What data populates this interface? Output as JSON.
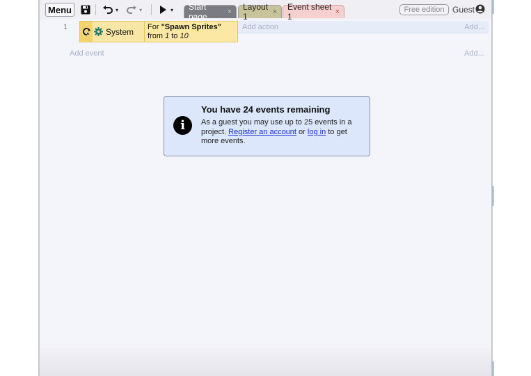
{
  "toolbar": {
    "menu_label": "Menu",
    "icons": [
      "save-icon",
      "undo-icon",
      "redo-icon",
      "play-icon"
    ],
    "undo_caret": "▾",
    "redo_caret": "▾",
    "play_caret": "▾"
  },
  "tabs": [
    {
      "label": "Start page",
      "close": "×"
    },
    {
      "label": "Layout 1",
      "close": "×"
    },
    {
      "label": "Event sheet 1",
      "close": "×"
    }
  ],
  "header_right": {
    "edition_badge": "Free edition",
    "user_label": "Guest"
  },
  "event_sheet": {
    "events": [
      {
        "number": "1",
        "object": "System",
        "condition_prefix": "For ",
        "condition_name": "\"Spawn Sprites\"",
        "condition_from": "from ",
        "condition_start": "1",
        "condition_to": " to ",
        "condition_end": "10",
        "add_action": "Add action",
        "add_more": "Add..."
      }
    ],
    "add_event": "Add event",
    "add_more": "Add..."
  },
  "notice": {
    "title": "You have 24 events remaining",
    "body_start": "As a guest you may use up to 25 events in a project. ",
    "register_link": "Register an account",
    "body_or": " or ",
    "login_link": "log in",
    "body_end": " to get more events."
  },
  "colors": {
    "condition_bg": "#f8e6a6",
    "action_bg": "#e6ecf8",
    "notice_bg": "#dce7fb",
    "link": "#1a2fd6",
    "event_tab": "#f6cfcf",
    "layout_tab": "#c9c39c",
    "start_tab": "#7b7b82"
  }
}
